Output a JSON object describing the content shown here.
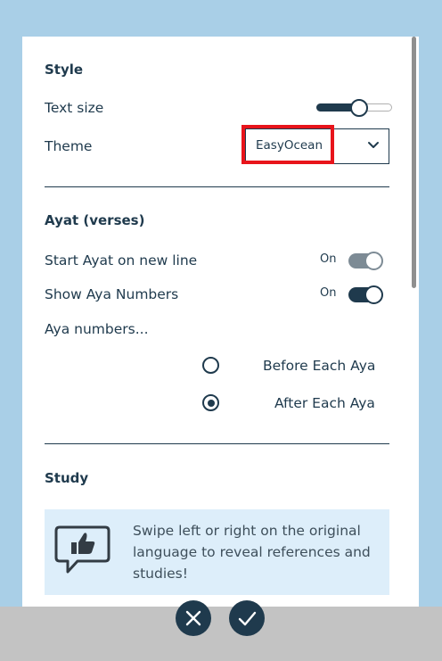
{
  "style": {
    "heading": "Style",
    "text_size_label": "Text size",
    "text_size_level": 0.56,
    "theme_label": "Theme",
    "theme_value": "EasyOcean"
  },
  "ayat": {
    "heading": "Ayat (verses)",
    "new_line_label": "Start Ayat on new line",
    "new_line_state": "On",
    "show_numbers_label": "Show Aya Numbers",
    "show_numbers_state": "On",
    "numbers_position_label": "Aya numbers...",
    "options": [
      {
        "label": "Before Each Aya",
        "selected": false
      },
      {
        "label": "After Each Aya",
        "selected": true
      }
    ]
  },
  "study": {
    "heading": "Study",
    "hint": "Swipe left or right on the original language to reveal references and studies!",
    "hint_icon": "thumbs-up-speech-bubble-icon"
  },
  "actions": {
    "cancel_icon": "close-icon",
    "confirm_icon": "check-icon"
  },
  "colors": {
    "accent": "#1f3a4d",
    "background": "#a9cfe7",
    "highlight": "#e8141b",
    "info_box": "#ddeefa",
    "toggle_light": "#7d8b95"
  }
}
